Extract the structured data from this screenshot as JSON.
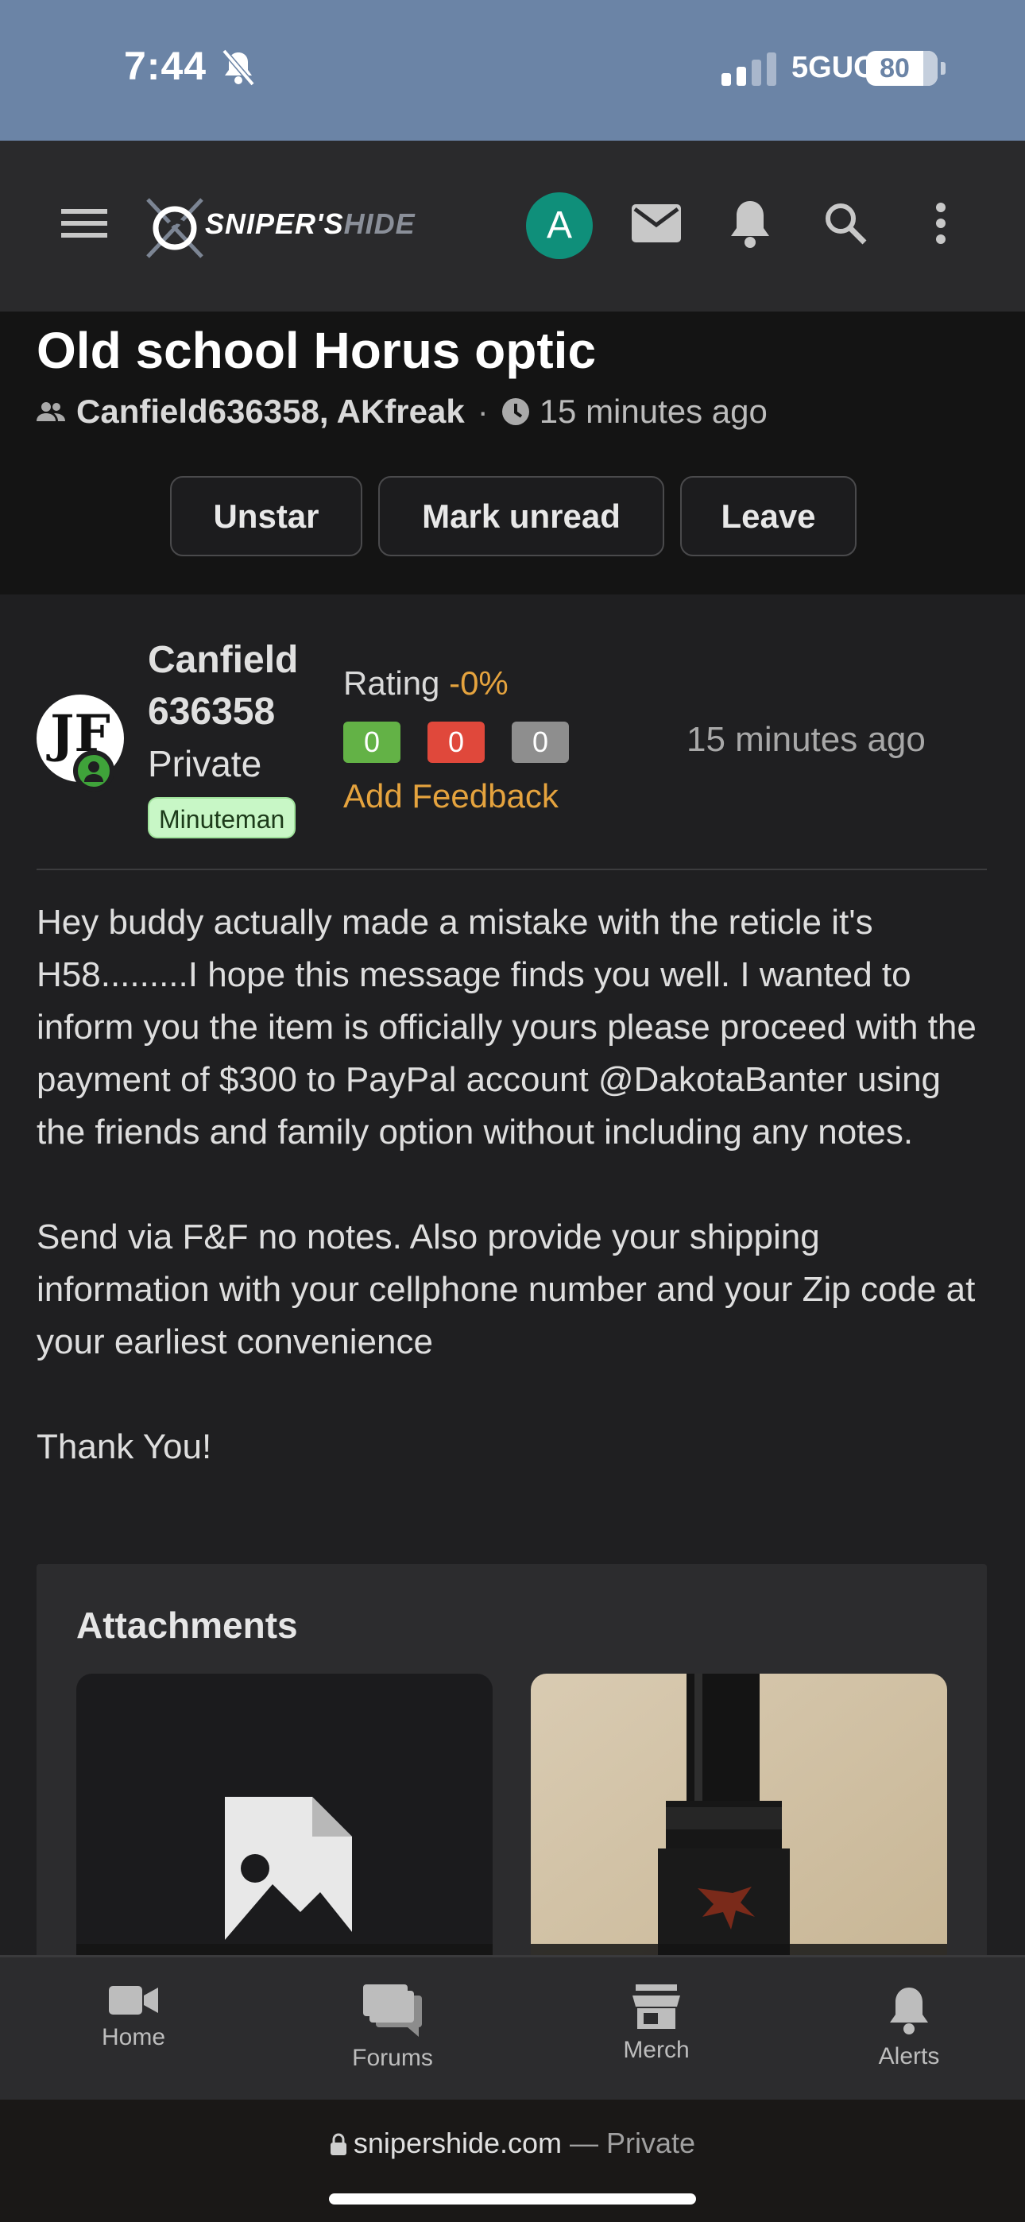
{
  "status": {
    "time": "7:44",
    "network": "5GUC",
    "battery": "80"
  },
  "header": {
    "logo_main": "SNIPER'S",
    "logo_accent": "HIDE",
    "avatar_letter": "A"
  },
  "conversation": {
    "title": "Old school Horus optic",
    "participants": "Canfield636358, AKfreak",
    "separator": "·",
    "time_ago": "15 minutes ago",
    "buttons": {
      "unstar": "Unstar",
      "mark_unread": "Mark unread",
      "leave": "Leave"
    }
  },
  "message": {
    "author": "Canfield 636358",
    "avatar_initials": "JF",
    "user_title": "Private",
    "badge": "Minuteman",
    "rating_label": "Rating ",
    "rating_value": "-0%",
    "feedback": {
      "positive": "0",
      "negative": "0",
      "neutral": "0"
    },
    "add_feedback": "Add Feedback",
    "time_ago": "15 minutes ago",
    "paragraphs": [
      "Hey buddy actually made a mistake with the reticle it's H58.........I hope this message finds you well. I wanted to inform you the item is officially yours please proceed with the payment of $300 to PayPal account @DakotaBanter using the friends and family option without including any notes.",
      "Send via F&F no notes. Also provide your shipping information with your cellphone number and your Zip code at your earliest convenience",
      "Thank You!"
    ],
    "attachments_heading": "Attachments"
  },
  "tabs": {
    "home": "Home",
    "forums": "Forums",
    "merch": "Merch",
    "alerts": "Alerts"
  },
  "browser": {
    "domain": "snipershide.com",
    "suffix": " — Private"
  }
}
